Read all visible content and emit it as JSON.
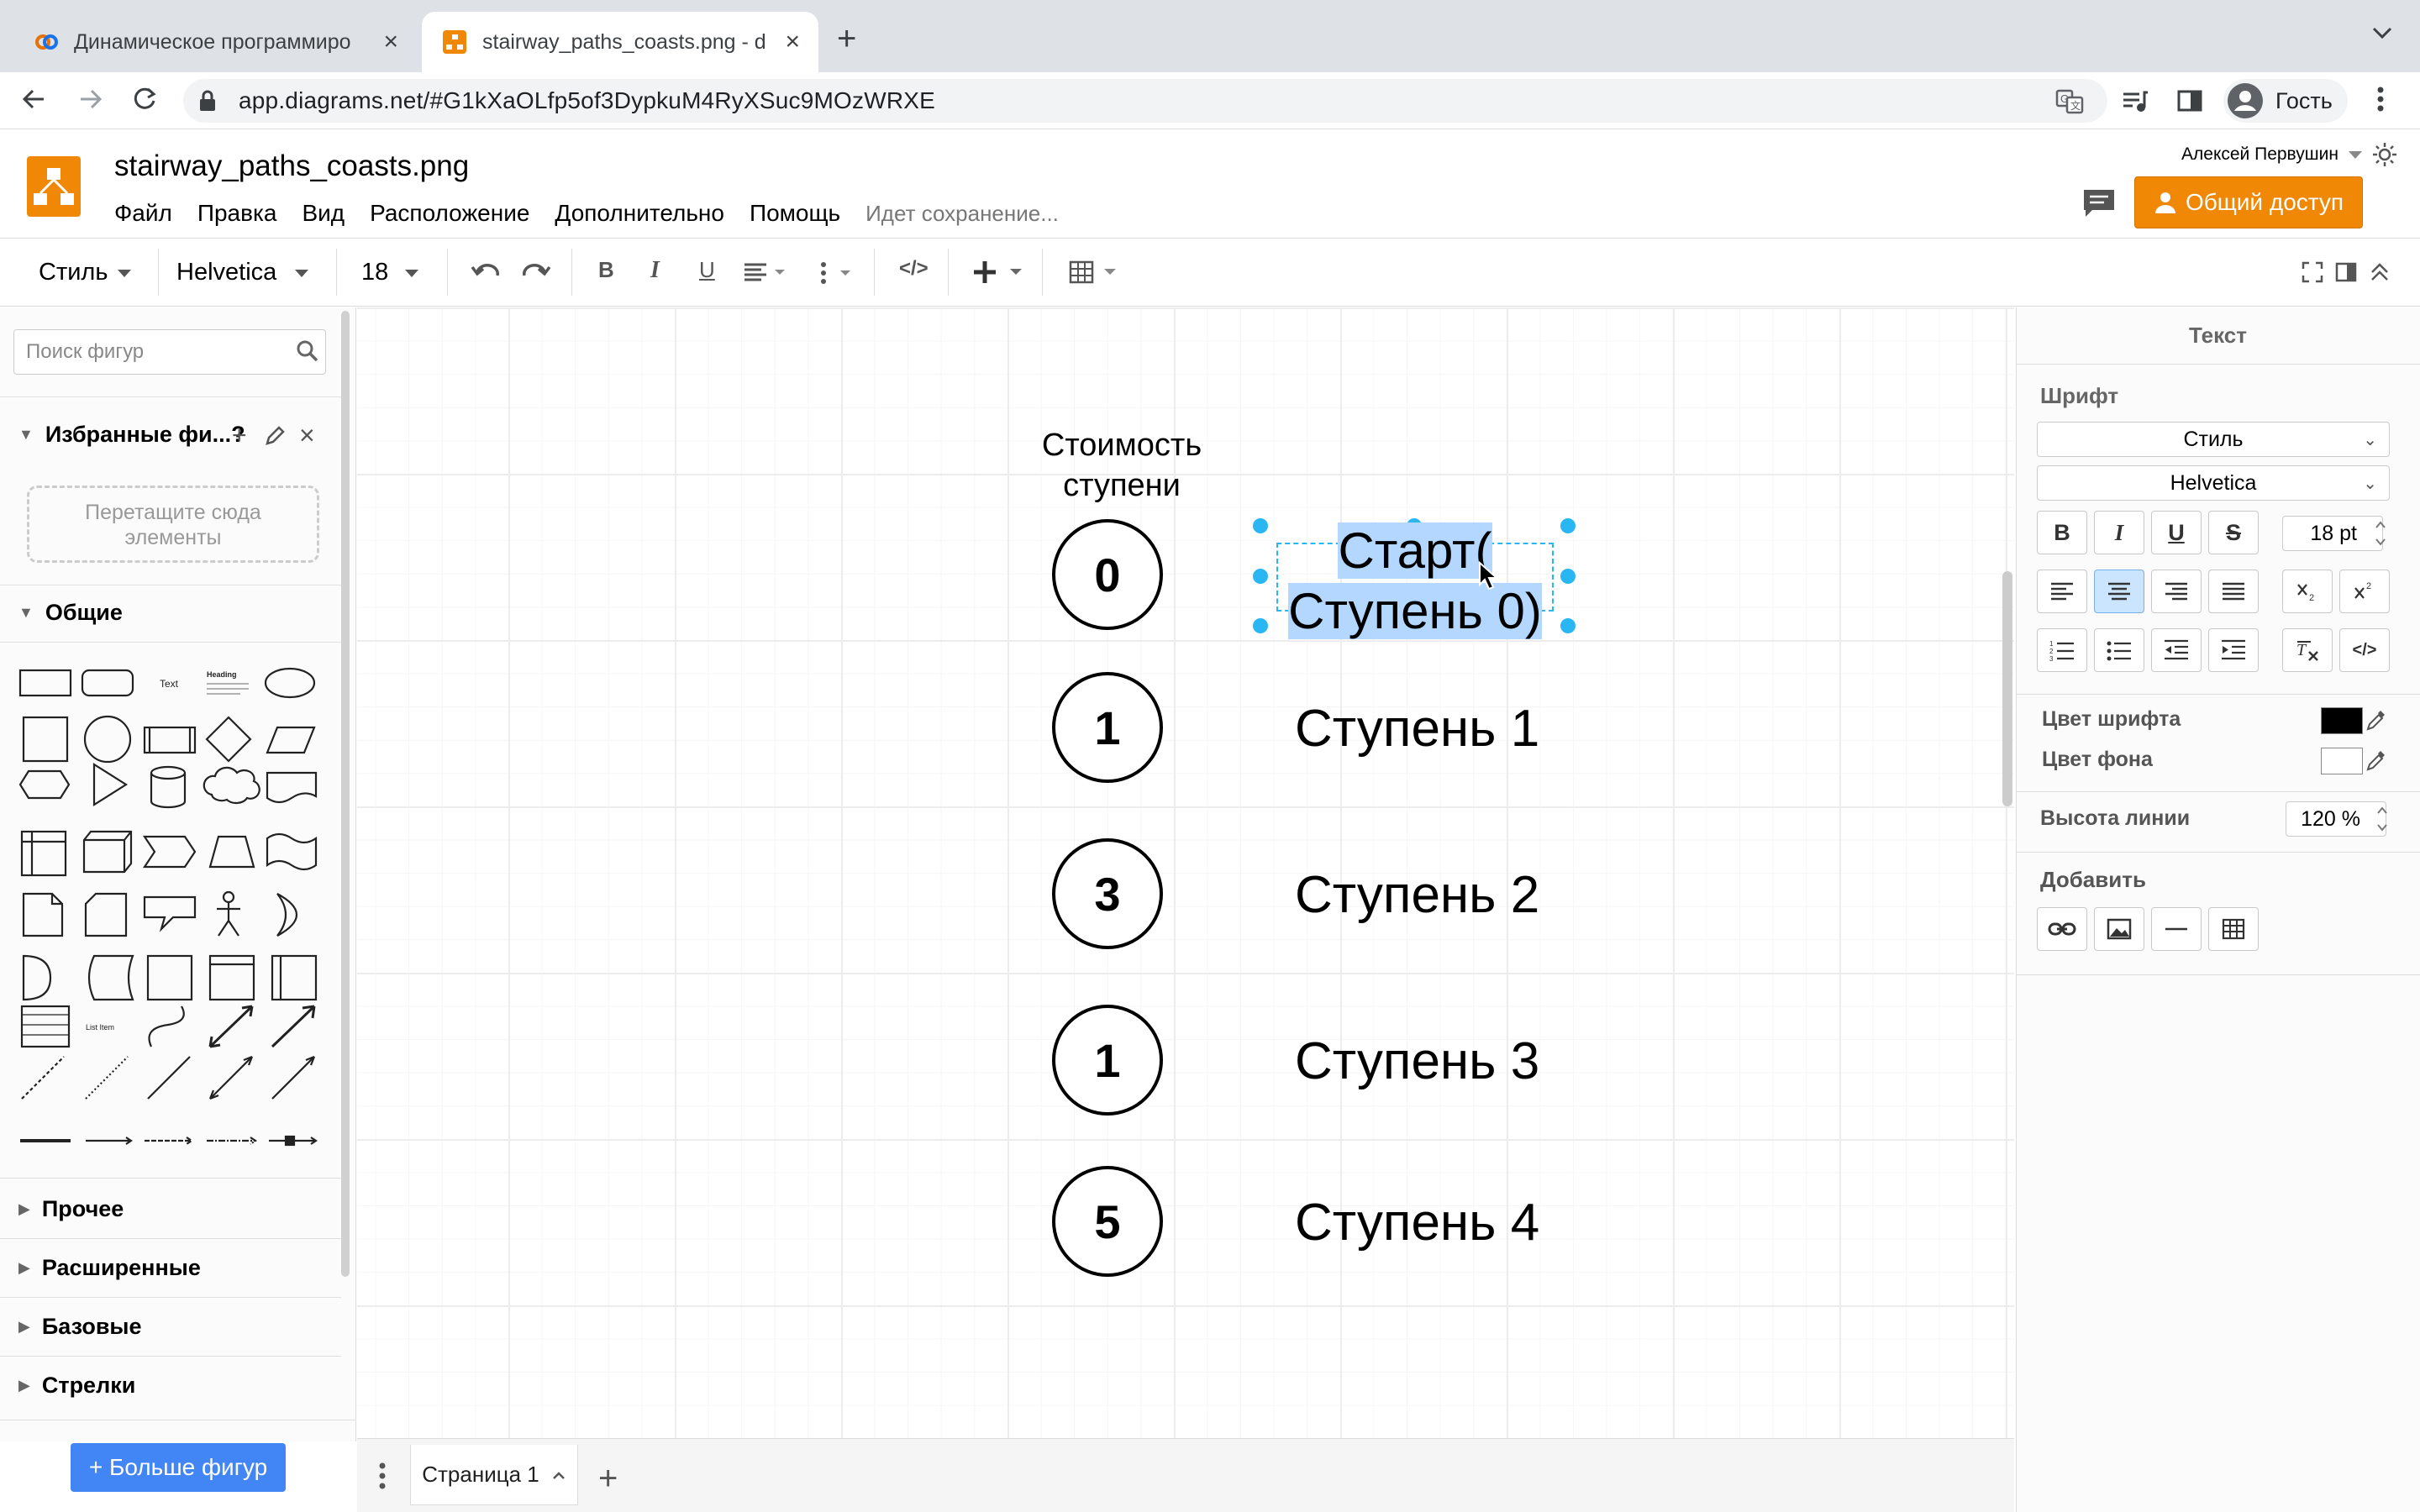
{
  "browser": {
    "tabs": [
      {
        "title": "Динамическое программиро",
        "active": false
      },
      {
        "title": "stairway_paths_coasts.png - d",
        "active": true
      }
    ],
    "url": "app.diagrams.net/#G1kXaOLfp5of3DypkuM4RyXSuc9MOzWRXE",
    "profile_label": "Гость"
  },
  "app": {
    "doc_title": "stairway_paths_coasts.png",
    "menu": [
      "Файл",
      "Правка",
      "Вид",
      "Расположение",
      "Дополнительно",
      "Помощь"
    ],
    "saving_status": "Идет сохранение...",
    "user_name": "Алексей Первушин",
    "share_label": "Общий доступ"
  },
  "toolbar": {
    "style_label": "Стиль",
    "font_label": "Helvetica",
    "size_label": "18"
  },
  "left_panel": {
    "search_placeholder": "Поиск фигур",
    "favorites_title": "Избранные фи...?",
    "dropzone_text_1": "Перетащите сюда",
    "dropzone_text_2": "элементы",
    "general_title": "Общие",
    "sections": [
      "Прочее",
      "Расширенные",
      "Базовые",
      "Стрелки"
    ],
    "more_shapes": "+ Больше фигур",
    "shape_text": "Text",
    "shape_heading": "Heading",
    "shape_list": "List Item"
  },
  "diagram": {
    "cost_title_line1": "Стоимость",
    "cost_title_line2": "ступени",
    "costs": [
      "0",
      "1",
      "3",
      "1",
      "5"
    ],
    "selected_label_line1": "Старт(",
    "selected_label_line2": "Ступень 0)",
    "step_labels": [
      "Ступень 1",
      "Ступень 2",
      "Ступень 3",
      "Ступень 4"
    ]
  },
  "page_bar": {
    "page_tab": "Страница 1"
  },
  "right_panel": {
    "title": "Текст",
    "font_section": "Шрифт",
    "style_select": "Стиль",
    "font_select": "Helvetica",
    "font_size": "18 pt",
    "font_color_label": "Цвет шрифта",
    "bg_color_label": "Цвет фона",
    "line_height_label": "Высота линии",
    "line_height_value": "120 %",
    "add_section": "Добавить",
    "font_color": "#000000",
    "bg_color": "#ffffff"
  },
  "colors": {
    "accent": "#f08705",
    "selection": "#29b6f2",
    "highlight": "#b3d7ff",
    "more_shapes_button": "#4285f4"
  }
}
